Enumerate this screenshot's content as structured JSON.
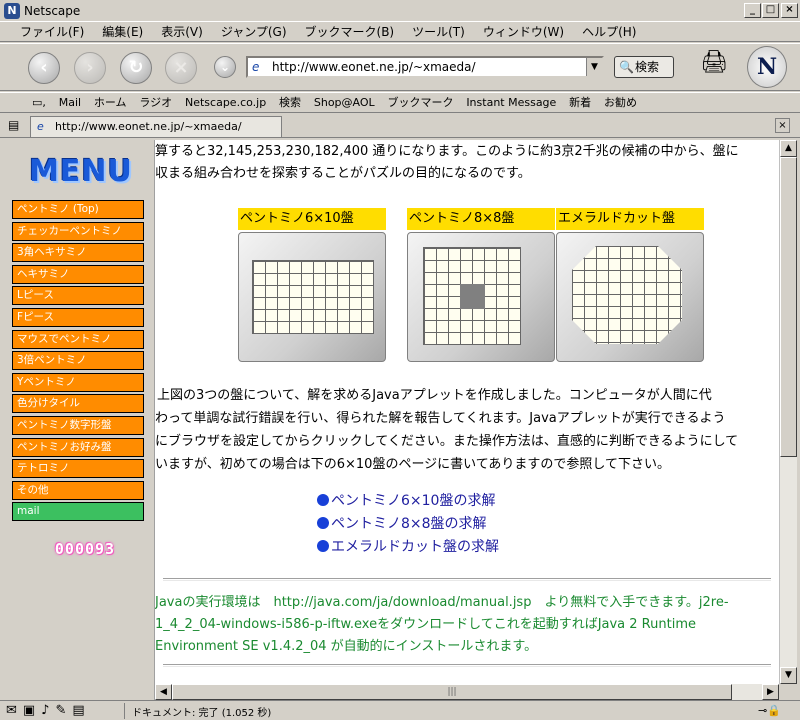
{
  "window": {
    "title": "Netscape",
    "minimize": "_",
    "maximize": "□",
    "close": "×"
  },
  "menubar": [
    "ファイル(F)",
    "編集(E)",
    "表示(V)",
    "ジャンプ(G)",
    "ブックマーク(B)",
    "ツール(T)",
    "ウィンドウ(W)",
    "ヘルプ(H)"
  ],
  "address": {
    "url": "http://www.eonet.ne.jp/~xmaeda/"
  },
  "search_button": "検索",
  "linkbar": [
    "Mail",
    "ホーム",
    "ラジオ",
    "Netscape.co.jp",
    "検索",
    "Shop@AOL",
    "ブックマーク",
    "Instant Message",
    "新着",
    "お勧め"
  ],
  "tab": {
    "url": "http://www.eonet.ne.jp/~xmaeda/"
  },
  "sidebar": {
    "logo": "MENU",
    "items": [
      "ペントミノ (Top)",
      "チェッカーペントミノ",
      "3角ヘキサミノ",
      "ヘキサミノ",
      "Lピース",
      "Fピース",
      "マウスでペントミノ",
      "3倍ペントミノ",
      "Yペントミノ",
      "色分けタイル",
      "ペントミノ数字形盤",
      "ペントミノお好み盤",
      "テトロミノ",
      "その他"
    ],
    "mail": "mail",
    "counter": "000093"
  },
  "content": {
    "intro_lines": [
      "算すると32,145,253,230,182,400 通りになります。このように約3京2千兆の候補の中から、盤に",
      "収まる組み合わせを探索することがパズルの目的になるのです。"
    ],
    "boards": [
      {
        "label": "ペントミノ6×10盤"
      },
      {
        "label": "ペントミノ8×8盤"
      },
      {
        "label": "エメラルドカット盤"
      }
    ],
    "para_lines": [
      "上図の3つの盤について、解を求めるJavaアプレットを作成しました。コンピュータが人間に代",
      "わって単調な試行錯誤を行い、得られた解を報告してくれます。Javaアプレットが実行できるよう",
      "にブラウザを設定してからクリックしてください。また操作方法は、直感的に判断できるようにして",
      "いますが、初めての場合は下の6×10盤のページに書いてありますので参照して下さい。"
    ],
    "links": [
      "ペントミノ6×10盤の求解",
      "ペントミノ8×8盤の求解",
      "エメラルドカット盤の求解"
    ],
    "java_note": [
      "Javaの実行環境は　http://java.com/ja/download/manual.jsp　より無料で入手できます。j2re-",
      "1_4_2_04-windows-i586-p-iftw.exeをダウンロードしてこれを起動すればJava 2 Runtime",
      "Environment SE v1.4.2_04 が自動的にインストールされます。"
    ]
  },
  "status": {
    "text": "ドキュメント: 完了 (1.052 秒)"
  },
  "colors": {
    "menu_item": "#ff8c00",
    "mail_item": "#3cc060",
    "board_label": "#ffdd00",
    "link": "#2020a0",
    "note": "#1a8a30"
  }
}
